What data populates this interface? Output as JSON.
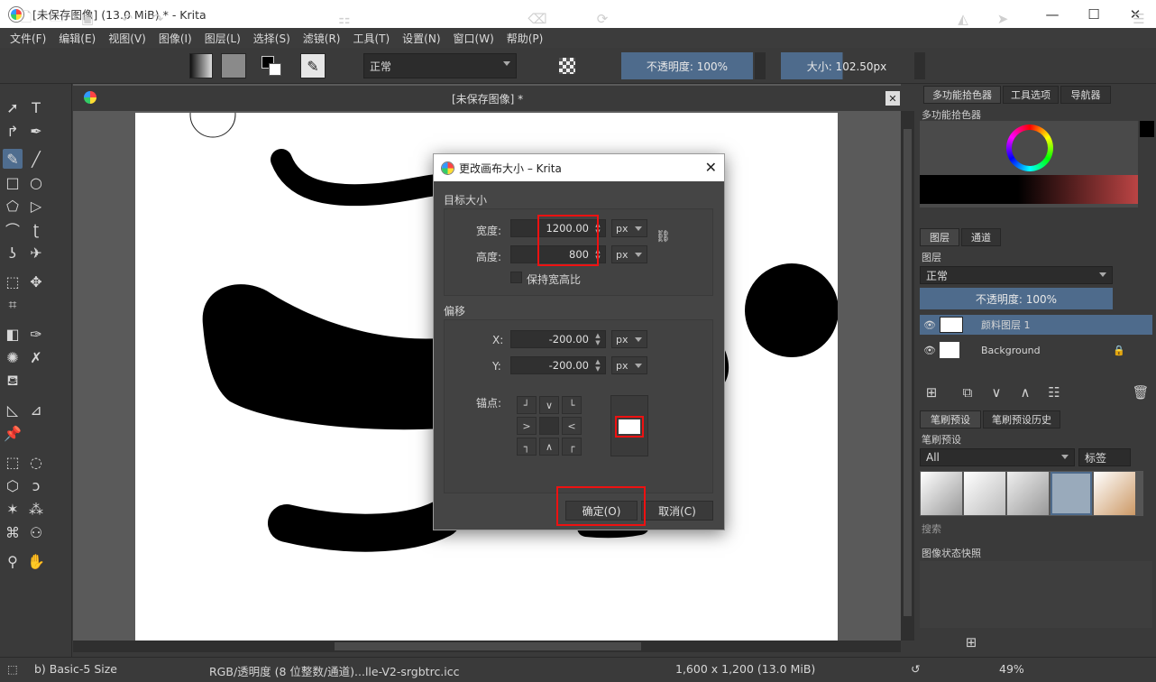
{
  "window": {
    "title": "[未保存图像]  (13.0 MiB)  * - Krita"
  },
  "menu": [
    "文件(F)",
    "编辑(E)",
    "视图(V)",
    "图像(I)",
    "图层(L)",
    "选择(S)",
    "滤镜(R)",
    "工具(T)",
    "设置(N)",
    "窗口(W)",
    "帮助(P)"
  ],
  "toolbar": {
    "blend_mode": "正常",
    "opacity_label": "不透明度: 100%",
    "size_label": "大小: 102.50px"
  },
  "canvas": {
    "tab_title": "[未保存图像]  *"
  },
  "dock": {
    "tabs_top": [
      "多功能拾色器",
      "工具选项",
      "导航器"
    ],
    "color_selector_title": "多功能拾色器",
    "tabs_layers": [
      "图层",
      "通道"
    ],
    "layers_title": "图层",
    "layer_blend_mode": "正常",
    "layer_opacity": "不透明度:  100%",
    "layers": [
      {
        "name": "颜料图层 1",
        "selected": true
      },
      {
        "name": "Background",
        "selected": false
      }
    ],
    "tabs_brush": [
      "笔刷预设",
      "笔刷预设历史"
    ],
    "brush_title": "笔刷预设",
    "brush_filter": "All",
    "brush_tag": "标签",
    "brush_search": "搜索",
    "snapshot_title": "图像状态快照"
  },
  "status": {
    "brush": "b) Basic-5 Size",
    "color_space": "RGB/透明度 (8 位整数/通道)...lle-V2-srgbtrc.icc",
    "image_size": "1,600 x 1,200 (13.0 MiB)",
    "zoom": "49%"
  },
  "dialog": {
    "title": "更改画布大小 – Krita",
    "target_size_label": "目标大小",
    "width_label": "宽度:",
    "width_value": "1200.00",
    "height_label": "高度:",
    "height_value": "800",
    "unit": "px",
    "keep_ratio_label": "保持宽高比",
    "offset_label": "偏移",
    "x_label": "X:",
    "x_value": "-200.00",
    "y_label": "Y:",
    "y_value": "-200.00",
    "anchor_label": "锚点:",
    "anchor_glyphs": [
      "┘",
      "∨",
      "└",
      ">",
      "",
      "<",
      "┐",
      "∧",
      "┌"
    ],
    "ok_label": "确定(O)",
    "cancel_label": "取消(C)"
  },
  "colors": {
    "accent": "#4e6b8c",
    "highlight_red": "#e11111"
  }
}
